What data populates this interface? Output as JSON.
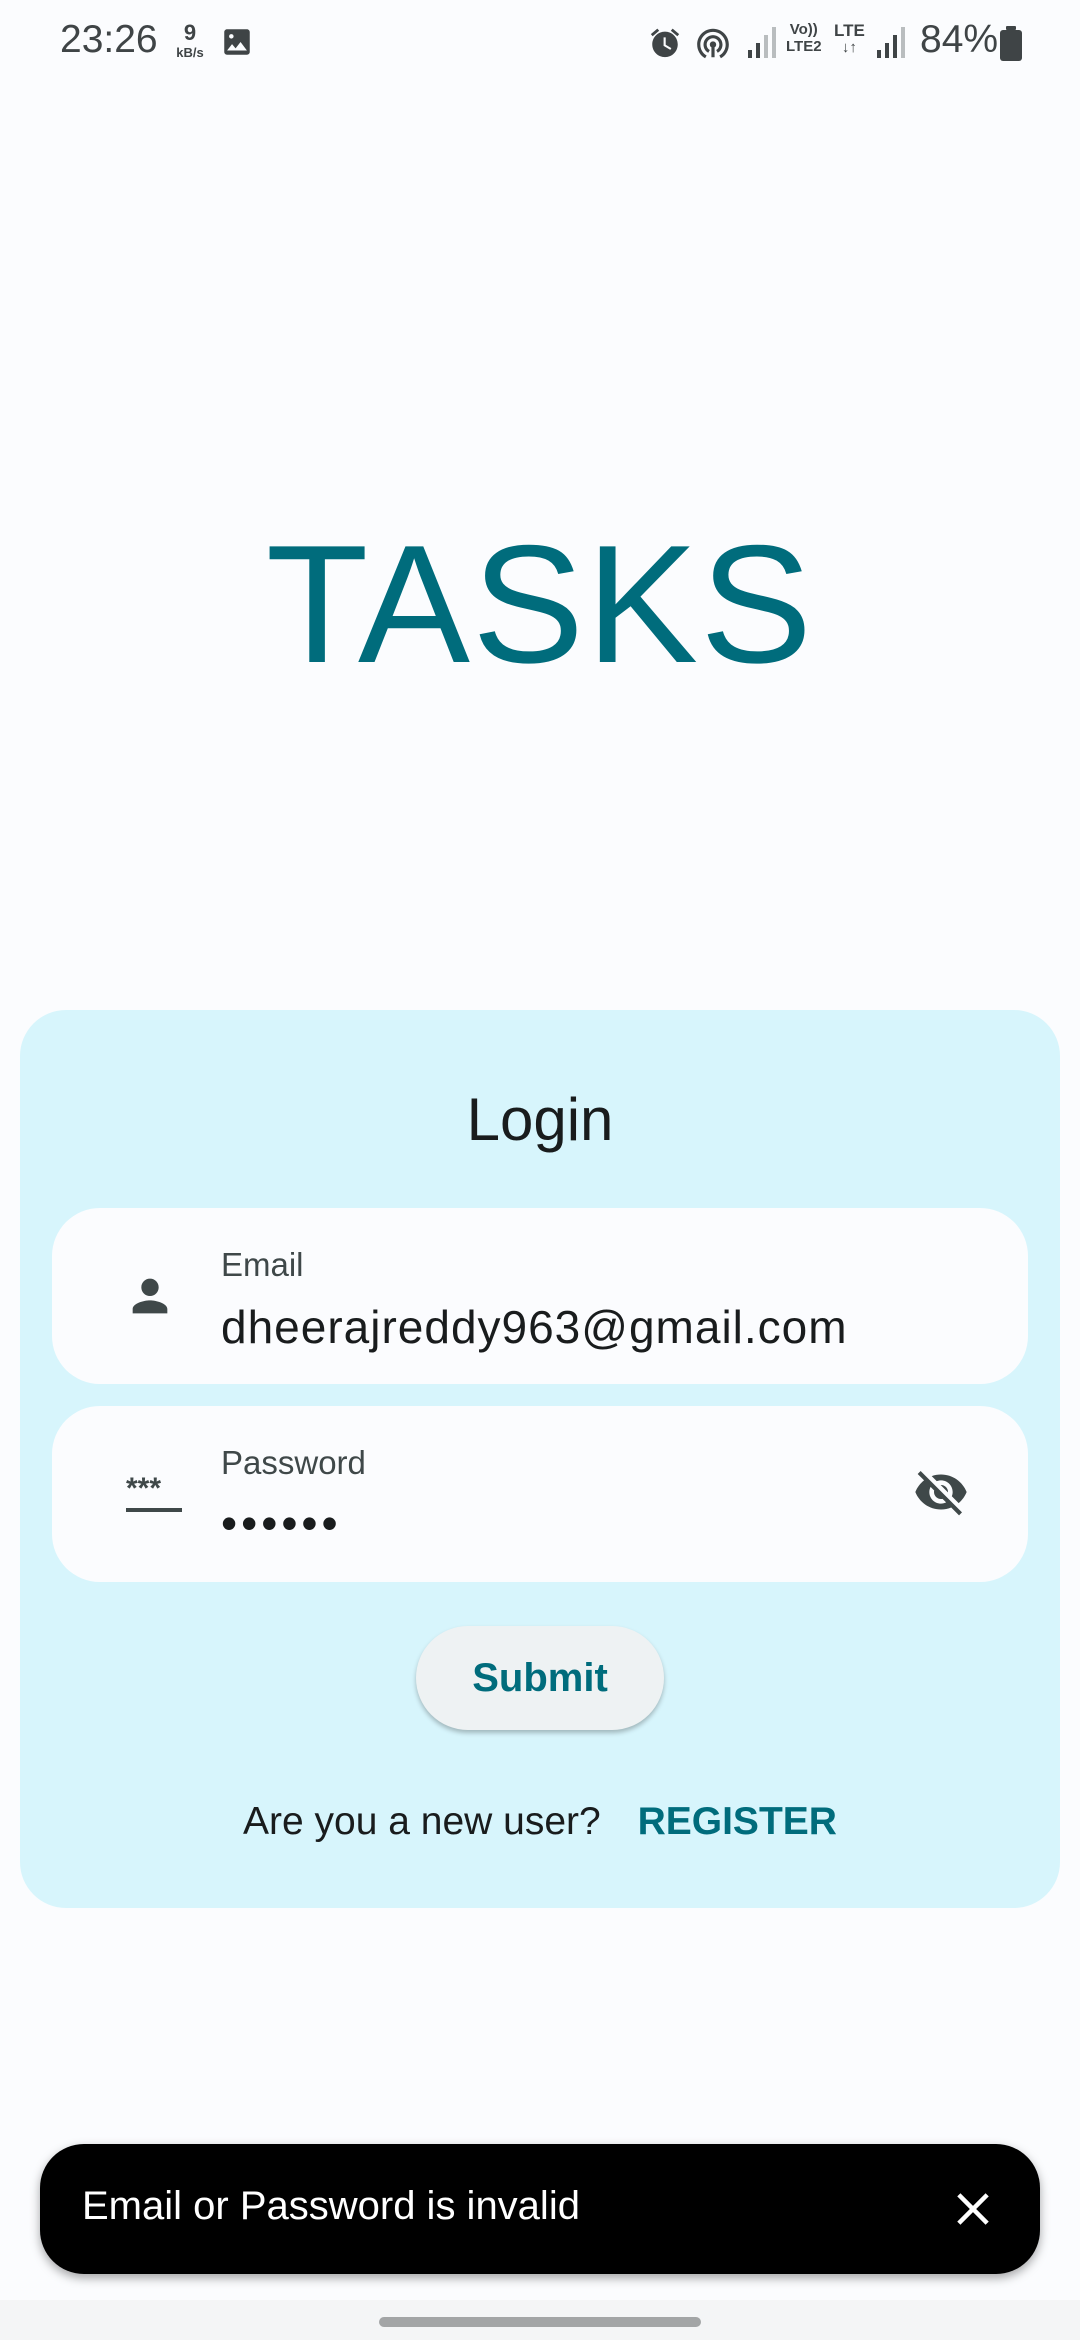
{
  "status_bar": {
    "time": "23:26",
    "net_speed_value": "9",
    "net_speed_unit": "kB/s",
    "volte_top": "Vo))",
    "volte_bottom": "LTE2",
    "lte_top": "LTE",
    "lte_bottom": "↓↑",
    "battery_percent": "84%",
    "icons": [
      "gallery-icon",
      "alarm-icon",
      "hotspot-icon",
      "signal-icon",
      "battery-icon"
    ]
  },
  "app": {
    "title": "TASKS",
    "accent_color": "#006c7c",
    "card_color": "#d7f5fc"
  },
  "login": {
    "title": "Login",
    "email": {
      "label": "Email",
      "value": "dheerajreddy963@gmail.com",
      "icon": "person-icon"
    },
    "password": {
      "label": "Password",
      "value": "••••••",
      "icon": "password-icon",
      "toggle_icon": "visibility-off-icon"
    },
    "submit_label": "Submit",
    "register_prompt": "Are you a new user?",
    "register_label": "REGISTER"
  },
  "snackbar": {
    "message": "Email or Password is invalid",
    "close_icon": "close-icon"
  }
}
